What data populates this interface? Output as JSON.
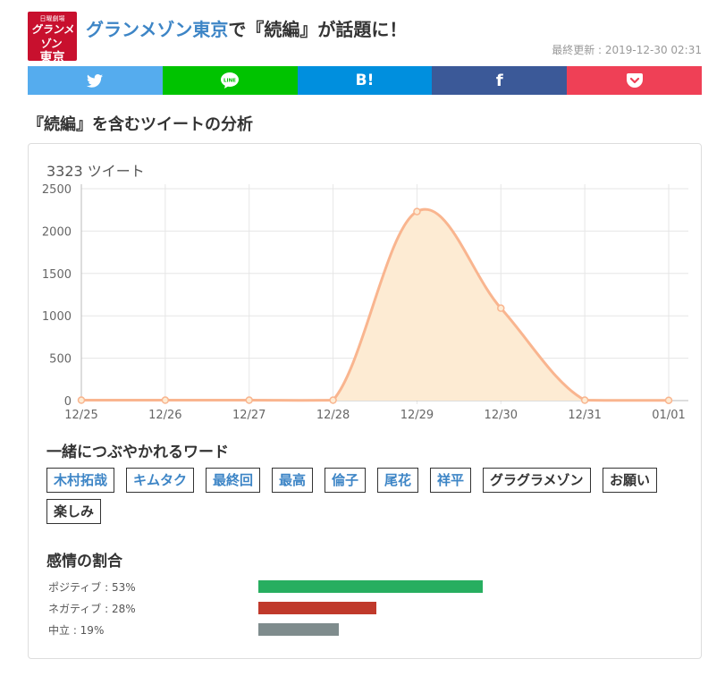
{
  "header": {
    "logo_line1": "日曜劇場",
    "logo_line2": "グランメゾン",
    "logo_line3": "東京",
    "title_link": "グランメゾン東京",
    "title_rest": "で『続編』が話題に！",
    "updated": "最終更新 : 2019-12-30 02:31"
  },
  "share": {
    "line_label": "LINE",
    "hatena_label": "B!",
    "facebook_label": "f",
    "colors": {
      "twitter": "#55acee",
      "line": "#00c300",
      "hatena": "#008fde",
      "facebook": "#3b5998",
      "pocket": "#ef4056"
    }
  },
  "section_title": "『続編』を含むツイートの分析",
  "tweet_count": "3323 ツイート",
  "chart_data": {
    "type": "area",
    "categories": [
      "12/25",
      "12/26",
      "12/27",
      "12/28",
      "12/29",
      "12/30",
      "12/31",
      "01/01"
    ],
    "series": [
      {
        "values": [
          5,
          5,
          5,
          5,
          2230,
          1090,
          5,
          3
        ],
        "color": "#f9b58f",
        "fill": "#fdebd3"
      }
    ],
    "ylim": [
      0,
      2500
    ],
    "yticks": [
      0,
      500,
      1000,
      1500,
      2000,
      2500
    ],
    "grid": true
  },
  "words": {
    "title": "一緒につぶやかれるワード",
    "items": [
      {
        "label": "木村拓哉",
        "linked": true
      },
      {
        "label": "キムタク",
        "linked": true
      },
      {
        "label": "最終回",
        "linked": true
      },
      {
        "label": "最高",
        "linked": true
      },
      {
        "label": "倫子",
        "linked": true
      },
      {
        "label": "尾花",
        "linked": true
      },
      {
        "label": "祥平",
        "linked": true
      },
      {
        "label": "グラグラメゾン",
        "linked": false
      },
      {
        "label": "お願い",
        "linked": false
      },
      {
        "label": "楽しみ",
        "linked": false
      }
    ]
  },
  "sentiment": {
    "title": "感情の割合",
    "rows": [
      {
        "label": "ポジティブ : 53%",
        "value": 53,
        "color": "#27ae60"
      },
      {
        "label": "ネガティブ : 28%",
        "value": 28,
        "color": "#c0392b"
      },
      {
        "label": "中立 : 19%",
        "value": 19,
        "color": "#7f8c8d"
      }
    ]
  }
}
